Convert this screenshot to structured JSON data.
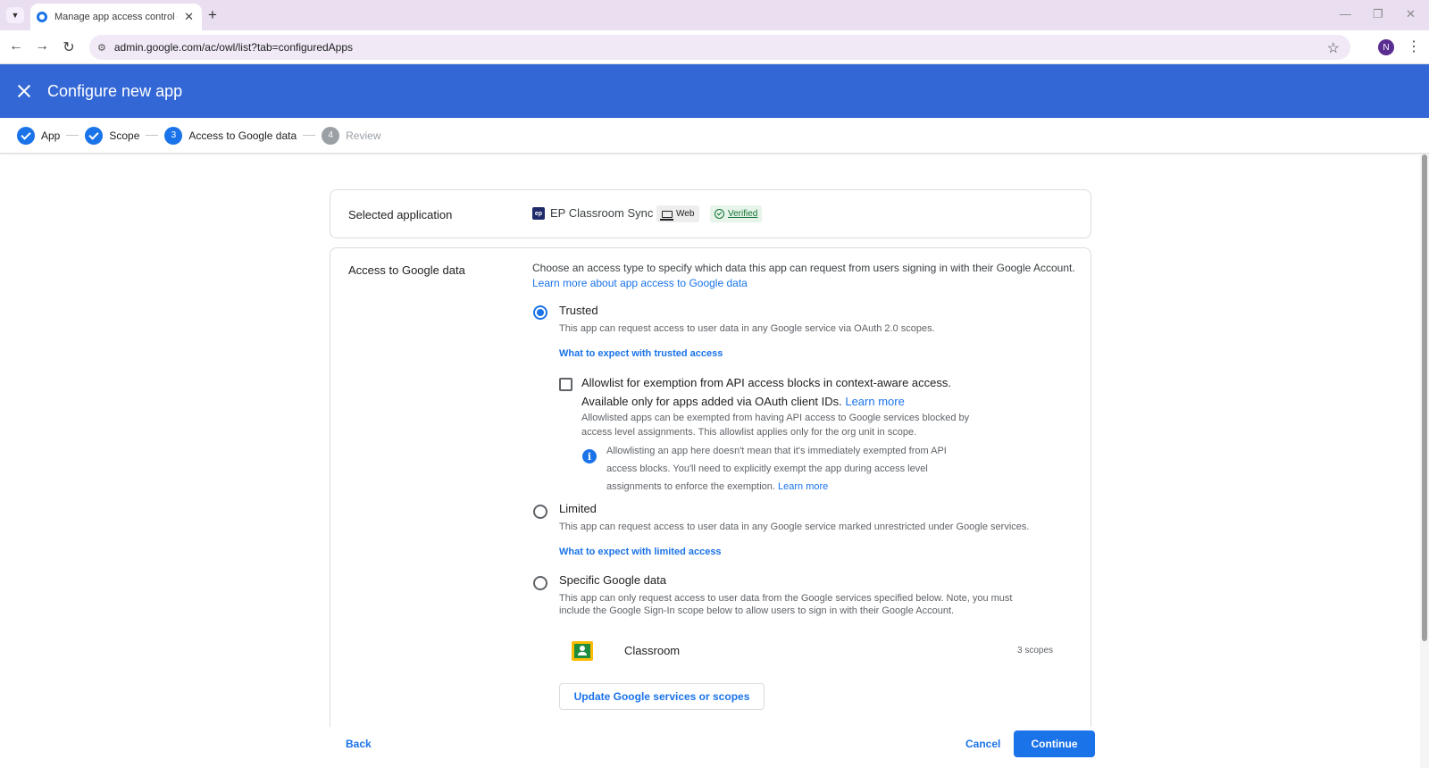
{
  "browser": {
    "tab_title": "Manage app access control – A",
    "url": "admin.google.com/ac/owl/list?tab=configuredApps",
    "profile_initial": "N"
  },
  "header": {
    "title": "Configure new app"
  },
  "stepper": {
    "steps": [
      {
        "label": "App",
        "state": "done"
      },
      {
        "label": "Scope",
        "state": "done"
      },
      {
        "number": "3",
        "label": "Access to Google data",
        "state": "current"
      },
      {
        "number": "4",
        "label": "Review",
        "state": "pending"
      }
    ]
  },
  "selected_application": {
    "label": "Selected application",
    "logo_text": "ep",
    "name": "EP Classroom Sync",
    "type_chip": "Web",
    "status_chip": "Verified"
  },
  "access": {
    "label": "Access to Google data",
    "intro": "Choose an access type to specify which data this app can request from users signing in with their Google Account.",
    "intro_link": "Learn more about app access to Google data",
    "selected_option": "Trusted",
    "options": {
      "trusted": {
        "title": "Trusted",
        "description": "This app can request access to user data in any Google service via OAuth 2.0 scopes.",
        "expect_link": "What to expect with trusted access"
      },
      "limited": {
        "title": "Limited",
        "description": "This app can request access to user data in any Google service marked unrestricted under Google services.",
        "expect_link": "What to expect with limited access"
      },
      "specific": {
        "title": "Specific Google data",
        "description_line1": "This app can only request access to user data from the Google services specified below. Note, you must",
        "description_line2": "include the Google Sign-In scope below to allow users to sign in with their Google Account."
      }
    },
    "allowlist": {
      "checked": false,
      "title_line1": "Allowlist for exemption from API access blocks in context-aware access.",
      "title_line2": "Available only for apps added via OAuth client IDs.",
      "title_link": "Learn more",
      "desc_line1": "Allowlisted apps can be exempted from having API access to Google services blocked by",
      "desc_line2": "access level assignments. This allowlist applies only for the org unit in scope.",
      "info_line1": "Allowlisting an app here doesn't mean that it's immediately exempted from API",
      "info_line2": "access blocks. You'll need to explicitly exempt the app during access level",
      "info_line3": "assignments to enforce the exemption.",
      "info_link": "Learn more"
    },
    "services": [
      {
        "name": "Classroom",
        "scopes": "3 scopes",
        "icon": "classroom-icon"
      }
    ],
    "update_button": "Update Google services or scopes"
  },
  "footer": {
    "back": "Back",
    "cancel": "Cancel",
    "continue": "Continue"
  },
  "colors": {
    "header_bg": "#3367d6",
    "accent": "#1a73e8",
    "verified": "#137333"
  }
}
